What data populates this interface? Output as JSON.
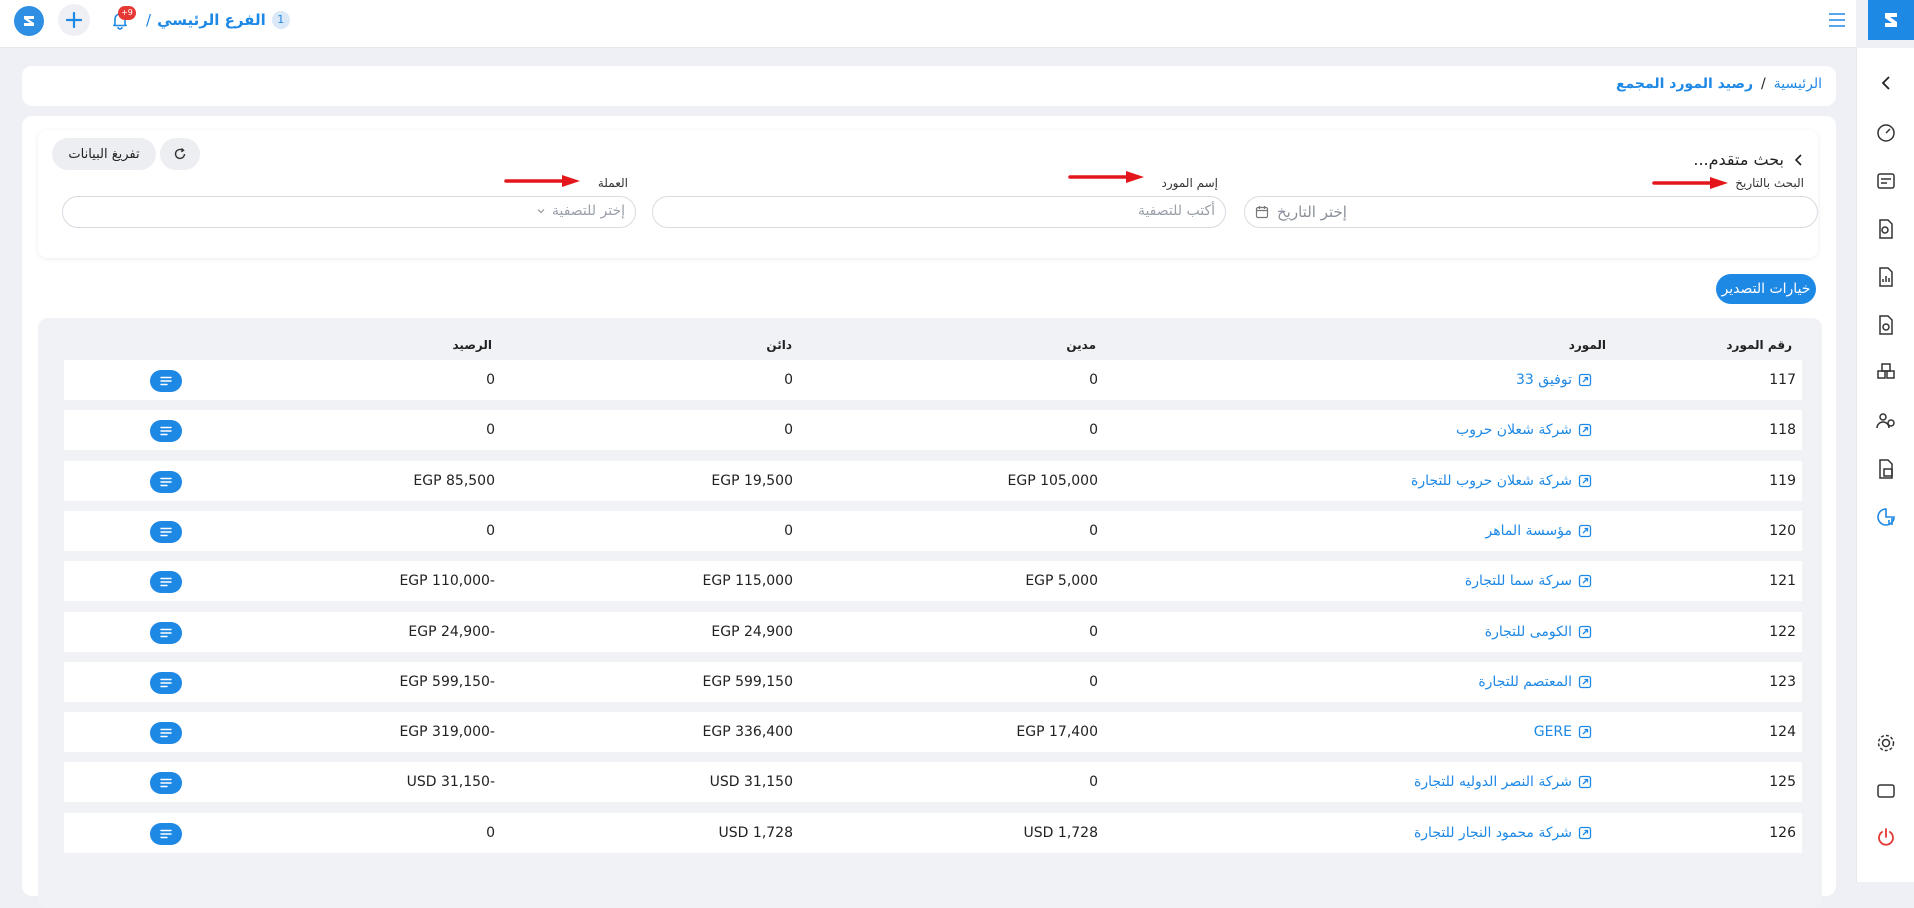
{
  "topbar": {
    "branch_badge": "1",
    "branch_name": "الفرع الرئيسي",
    "separator": "/",
    "notification_count": "+9"
  },
  "breadcrumb": {
    "home": "الرئيسية",
    "separator": "/",
    "current": "رصيد المورد المجمع"
  },
  "filters": {
    "advanced_search": "بحث متقدم...",
    "date_label": "البحث بالتاريخ",
    "date_placeholder": "إختر التاريخ",
    "supplier_label": "إسم المورد",
    "supplier_placeholder": "أكتب للتصفية",
    "currency_label": "العملة",
    "currency_placeholder": "إختر للتصفية",
    "clear_button": "تفريغ البيانات"
  },
  "export_button": "خيارات التصدير",
  "table": {
    "headers": {
      "number": "رقم المورد",
      "supplier": "المورد",
      "debit": "مدين",
      "credit": "دائن",
      "balance": "الرصيد"
    },
    "rows": [
      {
        "number": "117",
        "supplier": "توفيق 33",
        "debit": "0",
        "credit": "0",
        "balance": "0"
      },
      {
        "number": "118",
        "supplier": "شركة شعلان حروب",
        "debit": "0",
        "credit": "0",
        "balance": "0"
      },
      {
        "number": "119",
        "supplier": "شركة شعلان حروب للتجارة",
        "debit": "EGP 105,000",
        "credit": "EGP 19,500",
        "balance": "EGP 85,500"
      },
      {
        "number": "120",
        "supplier": "مؤسسة الماهر",
        "debit": "0",
        "credit": "0",
        "balance": "0"
      },
      {
        "number": "121",
        "supplier": "سركة سما للتجارة",
        "debit": "EGP 5,000",
        "credit": "EGP 115,000",
        "balance": "EGP 110,000-"
      },
      {
        "number": "122",
        "supplier": "الكومى للتجارة",
        "debit": "0",
        "credit": "EGP 24,900",
        "balance": "EGP 24,900-"
      },
      {
        "number": "123",
        "supplier": "المعتصم للتجارة",
        "debit": "0",
        "credit": "EGP 599,150",
        "balance": "EGP 599,150-"
      },
      {
        "number": "124",
        "supplier": "GERE",
        "debit": "EGP 17,400",
        "credit": "EGP 336,400",
        "balance": "EGP 319,000-"
      },
      {
        "number": "125",
        "supplier": "شركة النصر الدوليه للتجارة",
        "debit": "0",
        "credit": "USD 31,150",
        "balance": "USD 31,150-"
      },
      {
        "number": "126",
        "supplier": "شركة محمود النجار للتجارة",
        "debit": "USD 1,728",
        "credit": "USD 1,728",
        "balance": "0"
      }
    ]
  },
  "colors": {
    "accent": "#1e88e5",
    "arrow": "#e3161b",
    "power": "#e53935"
  }
}
